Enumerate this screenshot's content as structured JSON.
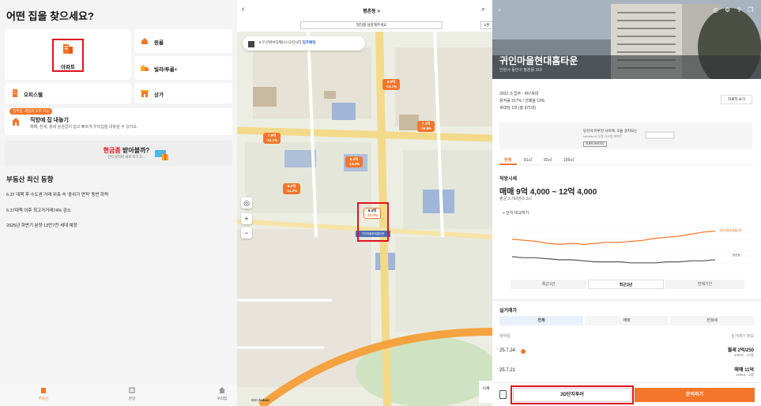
{
  "panel1": {
    "title": "어떤 집을 찾으세요?",
    "categories": {
      "apartment": "아파트",
      "oneroom": "원룸",
      "villa": "빌라/투룸+",
      "office": "오피스텔",
      "store": "상가"
    },
    "direct": {
      "badge": "집주인, 세입자 모두 가능",
      "title": "직방에 집 내놓기",
      "desc": "매매, 전세, 월세 상관없이 쉽고 빠르게 우리집을 내놓을 수 있어요."
    },
    "banner": {
      "title_hl": "현금좀",
      "title_rest": " 받아볼까?",
      "sub": "안터넷티비 새로 바꾸고..."
    },
    "news": {
      "heading": "부동산 최신 동향",
      "items": [
        "6.27 대책 후 수도권 거래 위축 속 '중위가 면적' 동반 하락",
        "6.27대책 이후 최고가거래74% 감소",
        "2025년 하반기 분양 13만7천 세대 예정"
      ]
    },
    "bottom_nav": [
      "부동산",
      "분양",
      "우리집"
    ]
  },
  "panel2": {
    "location": "평촌동 >",
    "filter": "필터를 설정해주세요",
    "filter2": "1천",
    "subway": "8  두산위브더제니스오션시티",
    "subway_tag": "입주예정",
    "pins": [
      {
        "price": "6.8억",
        "sub": "-14.1%"
      },
      {
        "price": "7.4억",
        "sub": "-16.8%"
      },
      {
        "price": "7.9억",
        "sub": "-13.1%"
      },
      {
        "price": "8.4억",
        "sub": "-13.5%"
      },
      {
        "price": "8.2억",
        "sub": "-11.2%"
      },
      {
        "price": "9.4억",
        "sub": "-12.4%"
      }
    ],
    "selected_name": "귀인마을현대홈타운",
    "scale": "50m",
    "map_logo": "kakao",
    "side_btn": "시세"
  },
  "panel3": {
    "name": "귀인마을현대홈타운",
    "address": "안양시 동안구 평촌동 318",
    "info_lines": [
      "2002. 6 입주 · 967세대",
      "용적률 317% / 건폐율 19%",
      "세대당 1대 (총 971대)"
    ],
    "detail_btn": "자세히 보기",
    "ad_text": "당신이 미루던 사이에, 모듈 설치되는",
    "ad_sub": "Infinitas AI 무풍 시스템 에어컨",
    "ad_btn": "자세히 보러가기",
    "area_tabs": [
      "전체",
      "81㎡",
      "92㎡",
      "109㎡"
    ],
    "price_section": "직방시세",
    "price_range": "매매 9억 4,000 ~ 12억 4,000",
    "avg_price": "평균 3,766만/3.3㎡",
    "compare": "+ 단지 비교하기",
    "chart_legend_top": "귀인마을현대홈타운",
    "chart_legend_bottom": "평촌동",
    "periods": [
      "최근1년",
      "최근3년",
      "전체기간"
    ],
    "trade_section": "실거래가",
    "trade_tabs": [
      "전체",
      "매매",
      "전월세"
    ],
    "th_left": "계약일",
    "th_right": "실거래가 정보",
    "trades": [
      {
        "date": "25.7.24",
        "price": "월세 2억/250",
        "sub": "109㎡ · 17층"
      },
      {
        "date": "25.7.21",
        "price": "매매 11억",
        "sub": "109㎡ · 2층"
      }
    ],
    "btn_3d": "3D단지투어",
    "btn_inquiry": "문의하기"
  },
  "chart_data": {
    "type": "line",
    "series": [
      {
        "name": "귀인마을현대홈타운",
        "values": [
          10.2,
          10.1,
          10.0,
          9.8,
          9.7,
          9.8,
          9.7,
          9.8,
          9.9,
          9.9,
          10.0,
          10.1,
          10.3,
          10.4,
          10.5,
          10.7,
          10.9,
          11.0
        ]
      },
      {
        "name": "평촌동",
        "values": [
          8.5,
          8.4,
          8.4,
          8.3,
          8.2,
          8.2,
          8.1,
          8.0,
          8.0,
          8.0,
          7.9,
          7.9,
          7.9,
          8.0,
          8.0,
          8.1,
          8.1,
          8.2
        ]
      }
    ],
    "color_top": "#f4762a",
    "color_bottom": "#555555",
    "ylim": [
      7.5,
      11.5
    ]
  }
}
